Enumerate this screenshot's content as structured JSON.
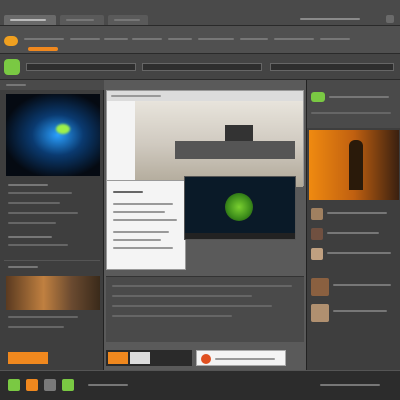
{
  "colors": {
    "accent_green": "#7ac943",
    "accent_orange": "#f0881e",
    "panel_dark": "#2c2c2c",
    "workspace_gray": "#5a5a5a"
  },
  "icons": {
    "app_logo": "app-logo-icon",
    "chat": "chat-bubble-icon",
    "play": "play-icon",
    "close": "close-icon"
  }
}
